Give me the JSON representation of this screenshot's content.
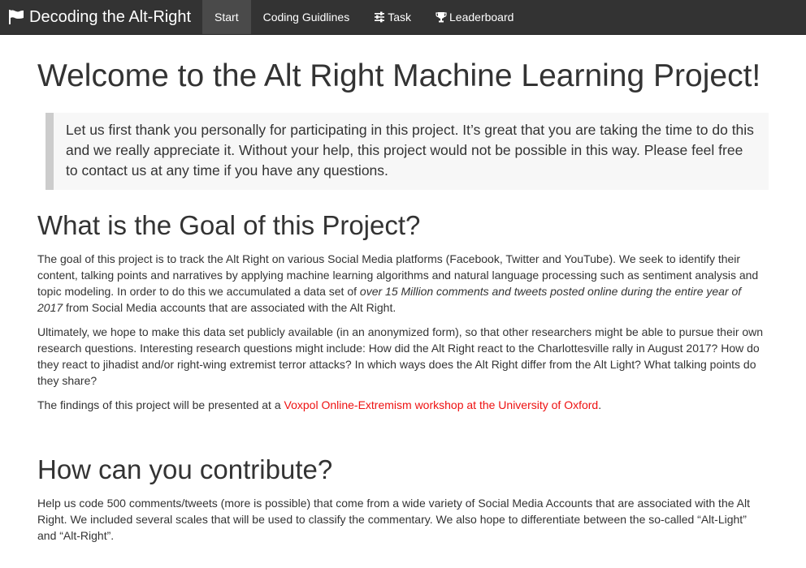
{
  "navbar": {
    "brand": "Decoding the Alt-Right",
    "items": [
      {
        "label": "Start",
        "active": true
      },
      {
        "label": "Coding Guidlines",
        "active": false
      },
      {
        "label": "Task",
        "active": false,
        "icon": "sliders-icon"
      },
      {
        "label": "Leaderboard",
        "active": false,
        "icon": "trophy-icon"
      }
    ]
  },
  "main": {
    "title": "Welcome to the Alt Right Machine Learning Project!",
    "intro": "Let us first thank you personally for participating in this project. It’s great that you are taking the time to do this and we really appreciate it. Without your help, this project would not be possible in this way. Please feel free to contact us at any time if you have any questions.",
    "goal": {
      "heading": "What is the Goal of this Project?",
      "p1_start": "The goal of this project is to track the Alt Right on various Social Media platforms (Facebook, Twitter and YouTube). We seek to identify their content, talking points and narratives by applying machine learning algorithms and natural language processing such as sentiment analysis and topic modeling. In order to do this we accumulated a data set of ",
      "p1_em": "over 15 Million comments and tweets posted online during the entire year of 2017",
      "p1_end": " from Social Media accounts that are associated with the Alt Right.",
      "p2": "Ultimately, we hope to make this data set publicly available (in an anonymized form), so that other researchers might be able to pursue their own research questions. Interesting research questions might include: How did the Alt Right react to the Charlottesville rally in August 2017? How do they react to jihadist and/or right-wing extremist terror attacks? In which ways does the Alt Right differ from the Alt Light? What talking points do they share?",
      "p3_start": "The findings of this project will be presented at a ",
      "p3_link": "Voxpol Online-Extremism workshop at the University of Oxford",
      "p3_end": "."
    },
    "contribute": {
      "heading": "How can you contribute?",
      "p1": "Help us code 500 comments/tweets (more is possible) that come from a wide variety of Social Media Accounts that are associated with the Alt Right. We included several scales that will be used to classify the commentary. We also hope to differentiate between the so-called “Alt-Light” and “Alt-Right”."
    }
  },
  "colors": {
    "navbar_bg": "#333333",
    "active_tab": "#4a4a4a",
    "link": "#ee1111",
    "quote_border": "#cccccc",
    "quote_bg": "#f7f7f7"
  }
}
